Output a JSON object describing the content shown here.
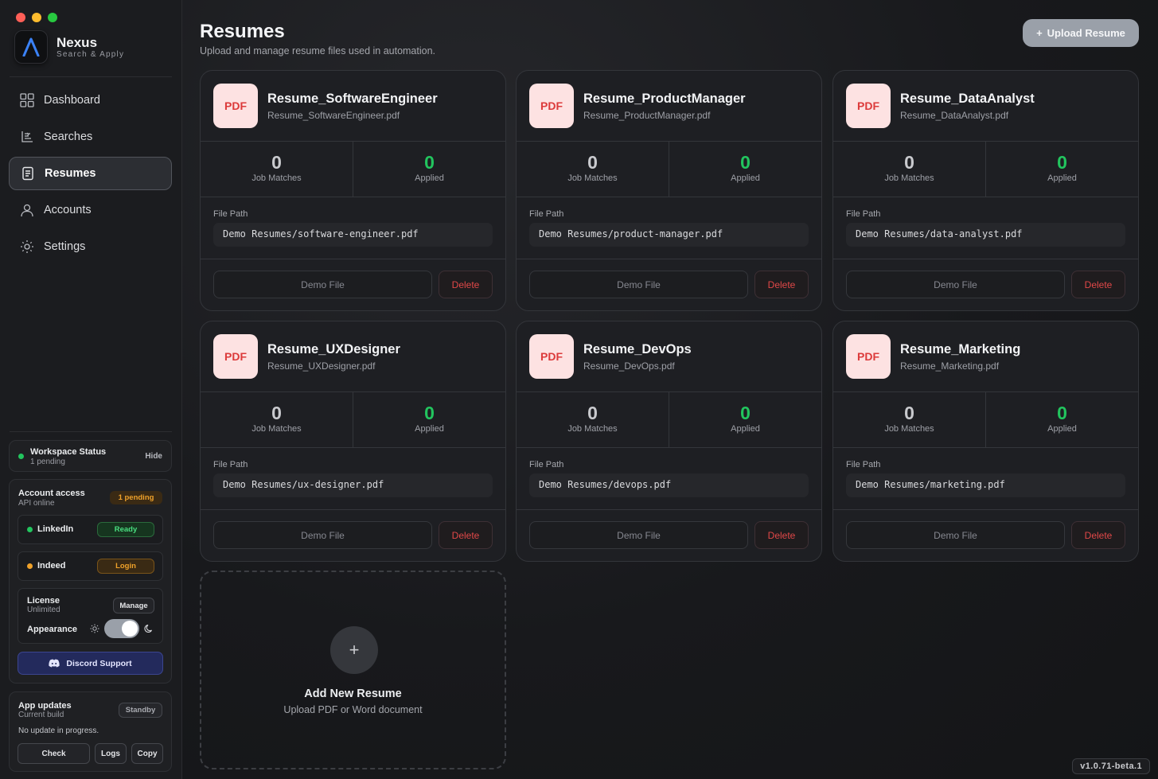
{
  "window": {
    "traffic_colors": [
      "#ff5f57",
      "#febc2e",
      "#28c840"
    ]
  },
  "brand": {
    "name": "Nexus",
    "subtitle": "Search & Apply"
  },
  "nav": {
    "dashboard": "Dashboard",
    "searches": "Searches",
    "resumes": "Resumes",
    "accounts": "Accounts",
    "settings": "Settings"
  },
  "workspace": {
    "title": "Workspace Status",
    "status": "1 pending",
    "hide_label": "Hide"
  },
  "account_access": {
    "title": "Account access",
    "subtitle": "API online",
    "badge": "1 pending",
    "linkedin": {
      "name": "LinkedIn",
      "status": "Ready"
    },
    "indeed": {
      "name": "Indeed",
      "status": "Login"
    }
  },
  "license": {
    "title": "License",
    "value": "Unlimited",
    "manage_label": "Manage",
    "appearance_label": "Appearance"
  },
  "discord": {
    "label": "Discord Support"
  },
  "updates": {
    "title": "App updates",
    "subtitle": "Current build",
    "badge": "Standby",
    "status": "No update in progress.",
    "check_label": "Check",
    "logs_label": "Logs",
    "copy_label": "Copy"
  },
  "header": {
    "title": "Resumes",
    "subtitle": "Upload and manage resume files used in automation.",
    "upload_label": "Upload Resume"
  },
  "labels": {
    "pdf": "PDF",
    "job_matches": "Job Matches",
    "applied": "Applied",
    "file_path": "File Path",
    "demo_file": "Demo File",
    "delete": "Delete"
  },
  "resumes": [
    {
      "name": "Resume_SoftwareEngineer",
      "file": "Resume_SoftwareEngineer.pdf",
      "matches": "0",
      "applied": "0",
      "path": "Demo Resumes/software-engineer.pdf"
    },
    {
      "name": "Resume_ProductManager",
      "file": "Resume_ProductManager.pdf",
      "matches": "0",
      "applied": "0",
      "path": "Demo Resumes/product-manager.pdf"
    },
    {
      "name": "Resume_DataAnalyst",
      "file": "Resume_DataAnalyst.pdf",
      "matches": "0",
      "applied": "0",
      "path": "Demo Resumes/data-analyst.pdf"
    },
    {
      "name": "Resume_UXDesigner",
      "file": "Resume_UXDesigner.pdf",
      "matches": "0",
      "applied": "0",
      "path": "Demo Resumes/ux-designer.pdf"
    },
    {
      "name": "Resume_DevOps",
      "file": "Resume_DevOps.pdf",
      "matches": "0",
      "applied": "0",
      "path": "Demo Resumes/devops.pdf"
    },
    {
      "name": "Resume_Marketing",
      "file": "Resume_Marketing.pdf",
      "matches": "0",
      "applied": "0",
      "path": "Demo Resumes/marketing.pdf"
    }
  ],
  "add_card": {
    "title": "Add New Resume",
    "subtitle": "Upload PDF or Word document"
  },
  "version": "v1.0.71-beta.1",
  "colors": {
    "accent_green": "#22c55e",
    "danger": "#e04848",
    "pending": "#f0a22a",
    "logo_blue": "#3b82f6"
  }
}
